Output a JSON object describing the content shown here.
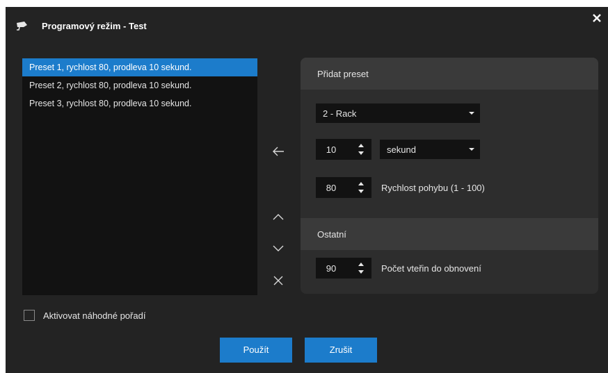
{
  "window": {
    "title": "Programový režim - Test",
    "close_icon": "close-icon",
    "camera_icon": "camera-icon"
  },
  "preset_list": {
    "items": [
      {
        "label": "Preset 1, rychlost 80, prodleva 10 sekund.",
        "selected": true
      },
      {
        "label": "Preset 2, rychlost 80, prodleva 10 sekund.",
        "selected": false
      },
      {
        "label": "Preset 3, rychlost 80, prodleva 10 sekund.",
        "selected": false
      }
    ]
  },
  "actions": {
    "add_icon": "arrow-left-icon",
    "move_up_icon": "chevron-up-icon",
    "move_down_icon": "chevron-down-icon",
    "remove_icon": "x-icon"
  },
  "add_preset": {
    "header": "Přidat preset",
    "preset_select": {
      "value": "2 - Rack"
    },
    "delay": {
      "value": "10"
    },
    "unit_select": {
      "value": "sekund"
    },
    "speed": {
      "value": "80",
      "label": "Rychlost pohybu (1 - 100)"
    }
  },
  "other": {
    "header": "Ostatní",
    "refresh": {
      "value": "90",
      "label": "Počet vteřin do obnovení"
    }
  },
  "random_order": {
    "label": "Aktivovat náhodné pořadí",
    "checked": false
  },
  "buttons": {
    "apply": "Použít",
    "cancel": "Zrušit"
  },
  "colors": {
    "accent": "#1c7ccb",
    "background": "#232323",
    "panel": "#2d2d2d",
    "section_header": "#3a3a3a",
    "input": "#121212"
  }
}
